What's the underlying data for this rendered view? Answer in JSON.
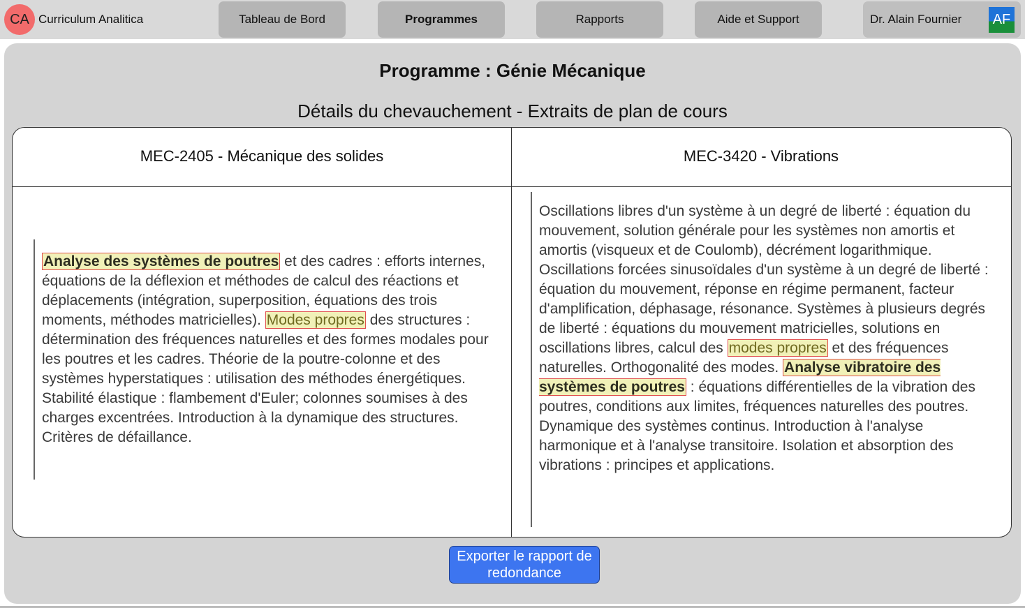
{
  "app": {
    "logo_initials": "CA",
    "name": "Curriculum Analitica"
  },
  "nav": [
    {
      "label": "Tableau de Bord",
      "active": false
    },
    {
      "label": "Programmes",
      "active": true
    },
    {
      "label": "Rapports",
      "active": false
    },
    {
      "label": "Aide et Support",
      "active": false
    }
  ],
  "user": {
    "name": "Dr. Alain Fournier",
    "initials": "AF"
  },
  "page": {
    "program_title": "Programme : Génie Mécanique",
    "subtitle": "Détails du chevauchement - Extraits de plan de cours"
  },
  "courses": [
    {
      "header": "MEC-2405 - Mécanique des solides",
      "segments": [
        {
          "text": "Analyse des systèmes de poutres",
          "highlight": "strong"
        },
        {
          "text": " et des cadres : efforts internes, équations de la déflexion et méthodes de calcul des réactions et déplacements (intégration, superposition, équations des trois moments, méthodes matricielles). ",
          "highlight": ""
        },
        {
          "text": "Modes propres",
          "highlight": "soft"
        },
        {
          "text": " des structures : détermination des fréquences naturelles et des formes modales pour les poutres et les cadres. Théorie de la poutre-colonne et des systèmes hyperstatiques : utilisation des méthodes énergétiques. Stabilité élastique : flambement d'Euler; colonnes soumises à des charges excentrées. Introduction à la dynamique des structures. Critères de défaillance.",
          "highlight": ""
        }
      ]
    },
    {
      "header": "MEC-3420 - Vibrations",
      "segments": [
        {
          "text": "Oscillations libres d'un système à un degré de liberté : équation du mouvement, solution générale pour les systèmes non amortis et amortis (visqueux et de Coulomb), décrément logarithmique. Oscillations forcées sinusoïdales d'un système à un degré de liberté : équation du mouvement, réponse en régime permanent, facteur d'amplification, déphasage, résonance. Systèmes à plusieurs degrés de liberté : équations du mouvement matricielles, solutions en oscillations libres, calcul des ",
          "highlight": ""
        },
        {
          "text": "modes propres",
          "highlight": "soft"
        },
        {
          "text": " et des fréquences naturelles. Orthogonalité des modes. ",
          "highlight": ""
        },
        {
          "text": "Analyse vibratoire des systèmes de poutres",
          "highlight": "strong"
        },
        {
          "text": " : équations différentielles de la vibration des poutres, conditions aux limites, fréquences naturelles des poutres. Dynamique des systèmes continus. Introduction à l'analyse harmonique et à l'analyse transitoire. Isolation et absorption des vibrations : principes et applications.",
          "highlight": ""
        }
      ]
    }
  ],
  "actions": {
    "export_label": "Exporter le rapport de redondance"
  }
}
